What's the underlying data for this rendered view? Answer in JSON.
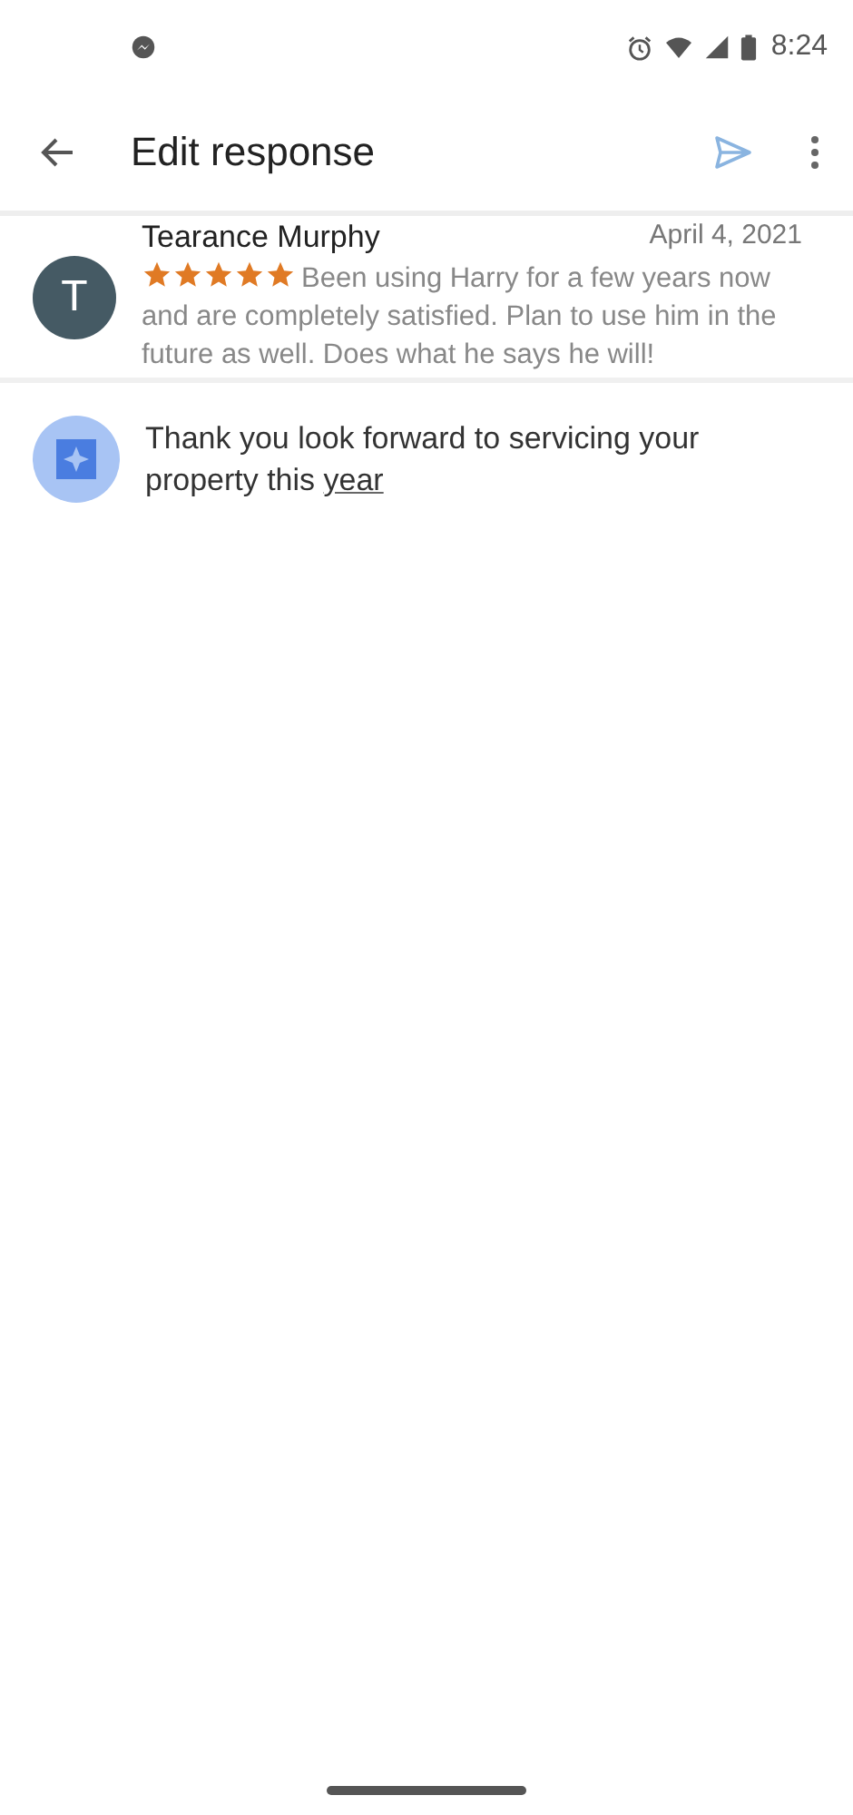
{
  "status_bar": {
    "time": "8:24"
  },
  "app_bar": {
    "title": "Edit response"
  },
  "review": {
    "avatar_letter": "T",
    "author": "Tearance Murphy",
    "date": "April 4, 2021",
    "stars": 5,
    "text": "Been using Harry for a few years now and are completely satisfied. Plan to use him in the future as well. Does what he says he will!"
  },
  "response": {
    "text": "Thank you look forward to servicing your property this",
    "composing_word": "year"
  }
}
